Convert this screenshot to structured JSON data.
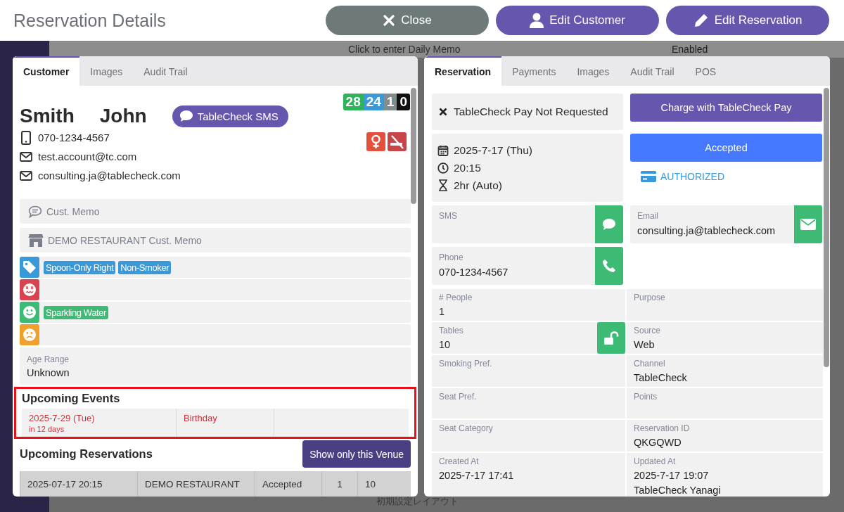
{
  "header": {
    "title": "Reservation Details",
    "buttons": [
      {
        "label": "Close",
        "kind": "close"
      },
      {
        "label": "Edit Customer",
        "kind": "customer"
      },
      {
        "label": "Edit Reservation",
        "kind": "reservation"
      }
    ]
  },
  "background": {
    "memo_prompt": "Click to enter Daily Memo",
    "status": "Enabled",
    "layout_name": "初期設定レイアウト"
  },
  "customer_panel": {
    "tabs": [
      {
        "label": "Customer",
        "selected": true
      },
      {
        "label": "Images",
        "selected": false
      },
      {
        "label": "Audit Trail",
        "selected": false
      }
    ],
    "visit_counts": [
      {
        "value": "28",
        "color": "#2fb35a"
      },
      {
        "value": "24",
        "color": "#3a9ad9"
      },
      {
        "value": "1",
        "color": "#7f8c8d"
      },
      {
        "value": "0",
        "color": "#111111"
      }
    ],
    "last_name": "Smith",
    "first_name": "John",
    "sms_button": "TableCheck SMS",
    "phone": "070-1234-4567",
    "emails": [
      "test.account@tc.com",
      "consulting.ja@tablecheck.com"
    ],
    "memos": [
      {
        "kind": "customer",
        "label": "Cust. Memo"
      },
      {
        "kind": "venue",
        "label": "DEMO RESTAURANT Cust. Memo"
      }
    ],
    "tag_rows": [
      {
        "kind": "tags",
        "tags": [
          "Spoon-Only Right",
          "Non-Smoker"
        ]
      },
      {
        "kind": "dislikes",
        "tags": []
      },
      {
        "kind": "likes",
        "tags": [
          "Sparkling Water"
        ]
      },
      {
        "kind": "neutral",
        "tags": []
      }
    ],
    "age_range": {
      "label": "Age Range",
      "value": "Unknown"
    },
    "upcoming_events": {
      "title": "Upcoming Events",
      "highlighted": true,
      "rows": [
        {
          "date": "2025-7-29 (Tue)",
          "relative": "in 12 days",
          "event": "Birthday"
        }
      ]
    },
    "upcoming_reservations": {
      "title": "Upcoming Reservations",
      "filter_button": "Show only this Venue",
      "rows": [
        {
          "cells": [
            "2025-07-17 20:15",
            "DEMO RESTAURANT",
            "Accepted",
            "1",
            "10"
          ]
        }
      ]
    }
  },
  "reservation_panel": {
    "tabs": [
      {
        "label": "Reservation",
        "selected": true
      },
      {
        "label": "Payments",
        "selected": false
      },
      {
        "label": "Images",
        "selected": false
      },
      {
        "label": "Audit Trail",
        "selected": false
      },
      {
        "label": "POS",
        "selected": false
      }
    ],
    "pay_status": "TableCheck Pay Not Requested",
    "charge_button": "Charge with TableCheck Pay",
    "schedule": {
      "date": "2025-7-17 (Thu)",
      "time": "20:15",
      "duration": "2hr (Auto)"
    },
    "status_button": "Accepted",
    "payment_status": "AUTHORIZED",
    "contacts": [
      {
        "kind": "sms",
        "label": "SMS"
      },
      {
        "kind": "email",
        "label": "Email",
        "value": "consulting.ja@tablecheck.com"
      },
      {
        "kind": "phone",
        "label": "Phone",
        "value": "070-1234-4567"
      }
    ],
    "fields": [
      {
        "kind": "plain",
        "label": "# People",
        "lines": [
          "1"
        ]
      },
      {
        "kind": "plain",
        "label": "Purpose"
      },
      {
        "kind": "lockable",
        "label": "Tables",
        "lines": [
          "10"
        ]
      },
      {
        "kind": "plain",
        "label": "Source",
        "lines": [
          "Web"
        ]
      },
      {
        "kind": "plain",
        "label": "Smoking Pref."
      },
      {
        "kind": "plain",
        "label": "Channel",
        "lines": [
          "TableCheck"
        ]
      },
      {
        "kind": "plain",
        "label": "Seat Pref."
      },
      {
        "kind": "plain",
        "label": "Points"
      },
      {
        "kind": "plain",
        "label": "Seat Category"
      },
      {
        "kind": "plain",
        "label": "Reservation ID",
        "lines": [
          "QKGQWD"
        ]
      },
      {
        "kind": "plain",
        "label": "Created At",
        "lines": [
          "2025-7-17 17:41"
        ]
      },
      {
        "kind": "plain",
        "label": "Updated At",
        "lines": [
          "2025-7-17 19:07",
          "TableCheck Yanagi"
        ]
      }
    ]
  }
}
